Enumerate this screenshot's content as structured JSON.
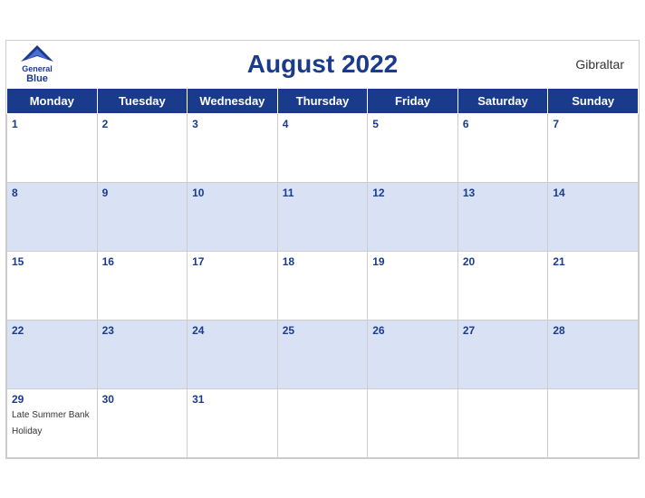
{
  "header": {
    "title": "August 2022",
    "region": "Gibraltar",
    "logo_general": "General",
    "logo_blue": "Blue"
  },
  "weekdays": [
    "Monday",
    "Tuesday",
    "Wednesday",
    "Thursday",
    "Friday",
    "Saturday",
    "Sunday"
  ],
  "weeks": [
    [
      {
        "date": "1",
        "shaded": false,
        "holiday": ""
      },
      {
        "date": "2",
        "shaded": false,
        "holiday": ""
      },
      {
        "date": "3",
        "shaded": false,
        "holiday": ""
      },
      {
        "date": "4",
        "shaded": false,
        "holiday": ""
      },
      {
        "date": "5",
        "shaded": false,
        "holiday": ""
      },
      {
        "date": "6",
        "shaded": false,
        "holiday": ""
      },
      {
        "date": "7",
        "shaded": false,
        "holiday": ""
      }
    ],
    [
      {
        "date": "8",
        "shaded": true,
        "holiday": ""
      },
      {
        "date": "9",
        "shaded": true,
        "holiday": ""
      },
      {
        "date": "10",
        "shaded": true,
        "holiday": ""
      },
      {
        "date": "11",
        "shaded": true,
        "holiday": ""
      },
      {
        "date": "12",
        "shaded": true,
        "holiday": ""
      },
      {
        "date": "13",
        "shaded": true,
        "holiday": ""
      },
      {
        "date": "14",
        "shaded": true,
        "holiday": ""
      }
    ],
    [
      {
        "date": "15",
        "shaded": false,
        "holiday": ""
      },
      {
        "date": "16",
        "shaded": false,
        "holiday": ""
      },
      {
        "date": "17",
        "shaded": false,
        "holiday": ""
      },
      {
        "date": "18",
        "shaded": false,
        "holiday": ""
      },
      {
        "date": "19",
        "shaded": false,
        "holiday": ""
      },
      {
        "date": "20",
        "shaded": false,
        "holiday": ""
      },
      {
        "date": "21",
        "shaded": false,
        "holiday": ""
      }
    ],
    [
      {
        "date": "22",
        "shaded": true,
        "holiday": ""
      },
      {
        "date": "23",
        "shaded": true,
        "holiday": ""
      },
      {
        "date": "24",
        "shaded": true,
        "holiday": ""
      },
      {
        "date": "25",
        "shaded": true,
        "holiday": ""
      },
      {
        "date": "26",
        "shaded": true,
        "holiday": ""
      },
      {
        "date": "27",
        "shaded": true,
        "holiday": ""
      },
      {
        "date": "28",
        "shaded": true,
        "holiday": ""
      }
    ],
    [
      {
        "date": "29",
        "shaded": false,
        "holiday": "Late Summer Bank Holiday"
      },
      {
        "date": "30",
        "shaded": false,
        "holiday": ""
      },
      {
        "date": "31",
        "shaded": false,
        "holiday": ""
      },
      {
        "date": "",
        "shaded": false,
        "holiday": ""
      },
      {
        "date": "",
        "shaded": false,
        "holiday": ""
      },
      {
        "date": "",
        "shaded": false,
        "holiday": ""
      },
      {
        "date": "",
        "shaded": false,
        "holiday": ""
      }
    ]
  ]
}
